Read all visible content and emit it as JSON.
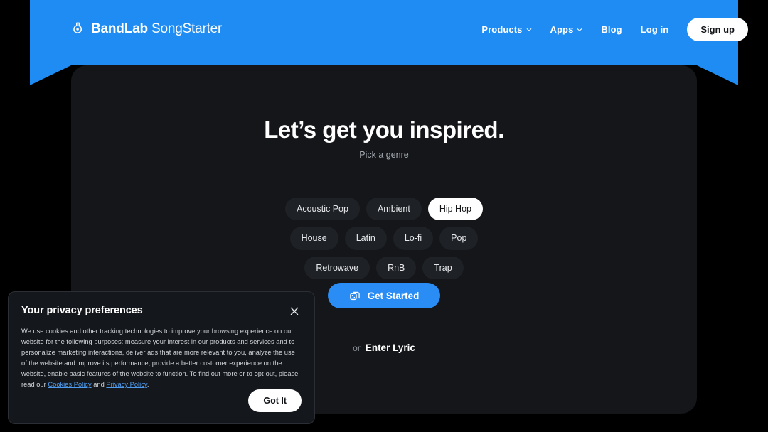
{
  "brand": {
    "name_bold": "BandLab",
    "name_light": "SongStarter",
    "logo_icon": "bandlab-logo-icon"
  },
  "nav": {
    "links": [
      {
        "label": "Products",
        "has_caret": true
      },
      {
        "label": "Apps",
        "has_caret": true
      },
      {
        "label": "Blog",
        "has_caret": false
      },
      {
        "label": "Log in",
        "has_caret": false
      }
    ],
    "signup_label": "Sign up"
  },
  "hero": {
    "title": "Let’s get you inspired.",
    "subtitle": "Pick a genre"
  },
  "genres": {
    "row1": [
      {
        "label": "Acoustic Pop",
        "selected": false
      },
      {
        "label": "Ambient",
        "selected": false
      },
      {
        "label": "Hip Hop",
        "selected": true
      },
      {
        "label": "House",
        "selected": false
      },
      {
        "label": "Latin",
        "selected": false
      }
    ],
    "row2": [
      {
        "label": "Lo-fi",
        "selected": false
      },
      {
        "label": "Pop",
        "selected": false
      },
      {
        "label": "Retrowave",
        "selected": false
      },
      {
        "label": "RnB",
        "selected": false
      },
      {
        "label": "Trap",
        "selected": false
      }
    ]
  },
  "cta": {
    "label": "Get Started",
    "icon": "shuffle-cards-icon"
  },
  "lyric": {
    "or_text": "or",
    "link_label": "Enter Lyric"
  },
  "cookie": {
    "title": "Your privacy preferences",
    "close_icon": "close-icon",
    "body_part1": "We use cookies and other tracking technologies to improve your browsing experience on our website for the following purposes: measure your interest in our products and services and to personalize marketing interactions, deliver ads that are more relevant to you, analyze the use of the website and improve its performance, provide a better customer experience on the website, enable basic features of the website to function. To find out more or to opt-out, please read our ",
    "link_cookies": "Cookies Policy",
    "body_and": " and ",
    "link_privacy": "Privacy Policy",
    "body_end": ".",
    "accept_label": "Got It"
  },
  "colors": {
    "brand_blue": "#1e8cf3",
    "cta_blue": "#2a8df5",
    "panel_bg": "#141619",
    "page_bg": "#000000",
    "chip_bg": "#1e2125",
    "chip_selected_bg": "#ffffff",
    "link_blue": "#4e9cf0"
  }
}
